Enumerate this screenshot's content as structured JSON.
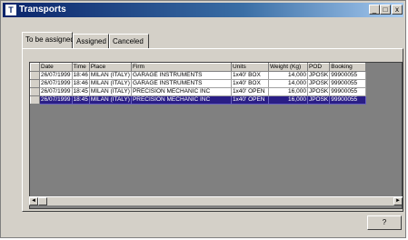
{
  "window": {
    "title": "Transports",
    "icon": "app-icon"
  },
  "titlebar_buttons": [
    "_",
    "□",
    "x"
  ],
  "tabs": [
    {
      "label": "To be assigned"
    },
    {
      "label": "Assigned"
    },
    {
      "label": "Canceled"
    }
  ],
  "table": {
    "columns": [
      "Date",
      "Time",
      "Place",
      "Firm",
      "Units",
      "Weight (Kg)",
      "POD",
      "Booking"
    ],
    "rows": [
      [
        "26/07/1999",
        "18:46",
        "MILAN (ITALY)",
        "GARAGE INSTRUMENTS",
        "1x40' BOX",
        "14,000",
        "JPOSK",
        "99900055"
      ],
      [
        "26/07/1999",
        "18:46",
        "MILAN (ITALY)",
        "GARAGE INSTRUMENTS",
        "1x40' BOX",
        "14,000",
        "JPOSK",
        "99900055"
      ],
      [
        "26/07/1999",
        "18:45",
        "MILAN (ITALY)",
        "PRECISION MECHANIC INC",
        "1x40' OPEN",
        "16,000",
        "JPOSK",
        "99900055"
      ],
      [
        "26/07/1999",
        "18:45",
        "MILAN (ITALY)",
        "PRECISION MECHANIC INC",
        "1x40' OPEN",
        "16,000",
        "JPOSK",
        "99900055"
      ]
    ],
    "selected_row": 3
  },
  "scroll": {
    "left": "◄",
    "right": "►"
  },
  "ok_button": {
    "label": "?"
  }
}
